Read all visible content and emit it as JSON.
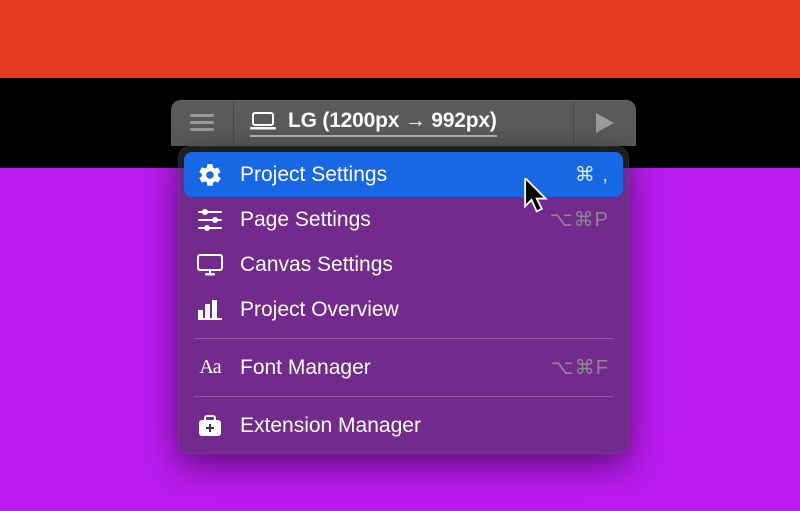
{
  "toolbar": {
    "breakpoint_label": "LG (1200px → 992px)"
  },
  "menu": {
    "items": [
      {
        "label": "Project Settings",
        "shortcut": "⌘ ,",
        "highlight": true
      },
      {
        "label": "Page Settings",
        "shortcut": "⌥⌘P",
        "highlight": false
      },
      {
        "label": "Canvas Settings",
        "shortcut": "",
        "highlight": false
      },
      {
        "label": "Project Overview",
        "shortcut": "",
        "highlight": false
      }
    ],
    "group2": [
      {
        "label": "Font Manager",
        "shortcut": "⌥⌘F"
      }
    ],
    "group3": [
      {
        "label": "Extension Manager",
        "shortcut": ""
      }
    ]
  }
}
